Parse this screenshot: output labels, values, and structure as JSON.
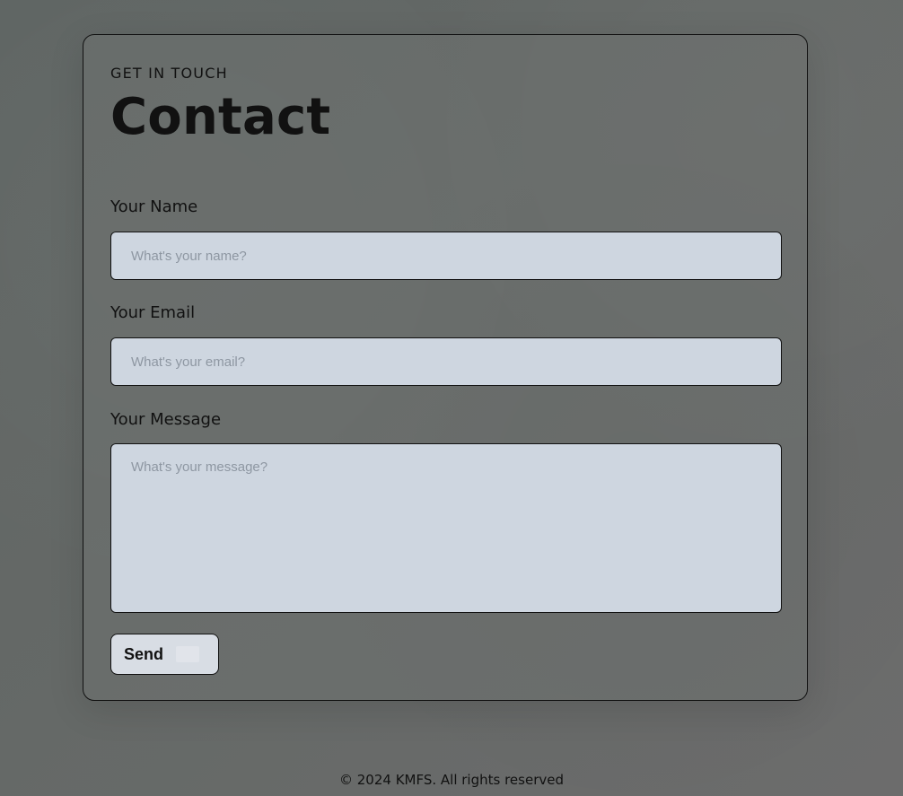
{
  "eyebrow": "GET IN TOUCH",
  "title": "Contact",
  "form": {
    "name_label": "Your Name",
    "name_placeholder": "What's your name?",
    "email_label": "Your Email",
    "email_placeholder": "What's your email?",
    "message_label": "Your Message",
    "message_placeholder": "What's your message?",
    "send_label": "Send",
    "send_icon": "send-icon"
  },
  "footer": {
    "copyright": "© 2024 KMFS. All rights reserved"
  },
  "colors": {
    "background": "#656967",
    "field_background": "#ced6e0",
    "button_background": "#d8dde4",
    "text": "#111111",
    "placeholder": "#8e97a2"
  }
}
